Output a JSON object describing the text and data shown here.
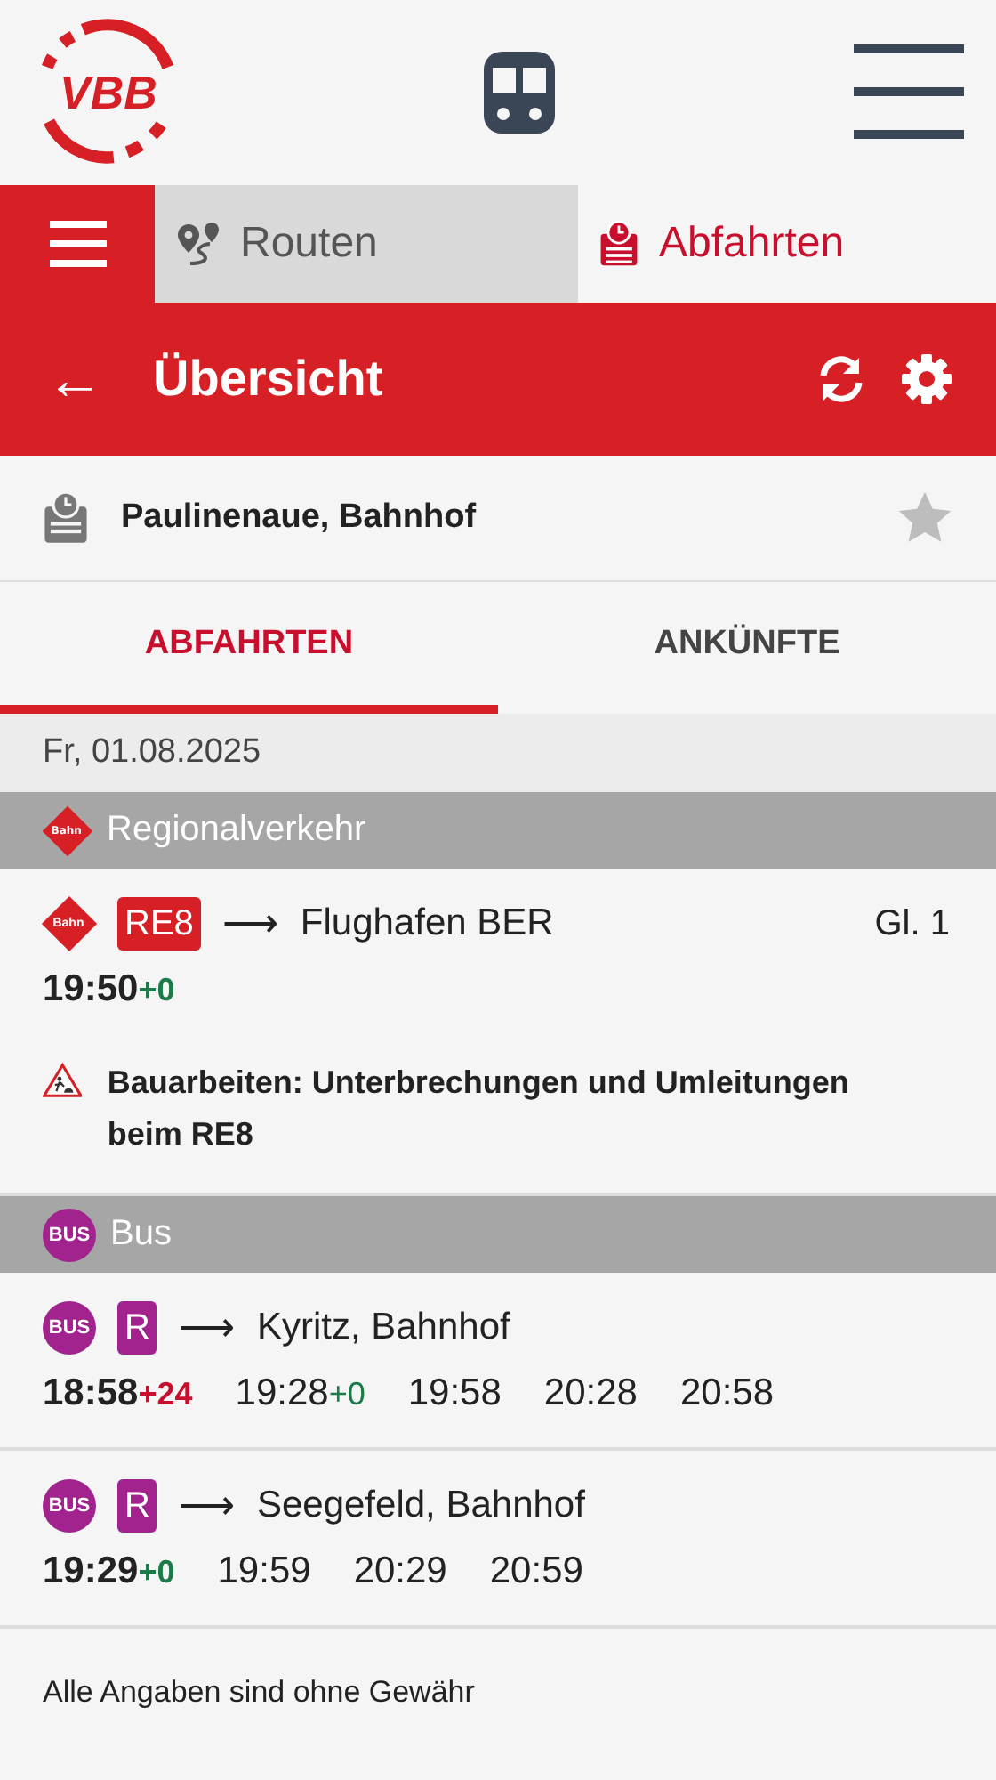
{
  "header": {
    "logo": "VBB"
  },
  "nav_tabs": [
    {
      "label": "Routen",
      "selected": false,
      "kind": "routes"
    },
    {
      "label": "Abfahrten",
      "selected": true,
      "kind": "departures"
    }
  ],
  "toolbar": {
    "back": "←",
    "title": "Übersicht"
  },
  "stop": {
    "name": "Paulinenaue, Bahnhof",
    "favorite": false
  },
  "tabs": [
    {
      "label": "ABFAHRTEN",
      "selected": true
    },
    {
      "label": "ANKÜNFTE",
      "selected": false
    }
  ],
  "date": "Fr, 01.08.2025",
  "sections": [
    {
      "title": "Regionalverkehr",
      "kind": "bahn",
      "mode_label": "Bahn",
      "entries": [
        {
          "mode_label": "Bahn",
          "line": "RE8",
          "color": "#d71f26",
          "arrow": "⟶",
          "destination": "Flughafen BER",
          "platform": "Gl. 1",
          "times": [
            {
              "time": "19:50",
              "delay": "+0",
              "late": false
            }
          ],
          "notice": "Bauarbeiten: Unterbrechungen und Umleitungen beim RE8"
        }
      ]
    },
    {
      "title": "Bus",
      "kind": "bus",
      "mode_label": "BUS",
      "entries": [
        {
          "mode_label": "BUS",
          "line": "R",
          "color": "#a3238e",
          "arrow": "⟶",
          "destination": "Kyritz, Bahnhof",
          "times": [
            {
              "time": "18:58",
              "delay": "+24",
              "late": true
            },
            {
              "time": "19:28",
              "delay": "+0",
              "late": false
            },
            {
              "time": "19:58"
            },
            {
              "time": "20:28"
            },
            {
              "time": "20:58"
            }
          ]
        },
        {
          "mode_label": "BUS",
          "line": "R",
          "color": "#a3238e",
          "arrow": "⟶",
          "destination": "Seegefeld, Bahnhof",
          "times": [
            {
              "time": "19:29",
              "delay": "+0",
              "late": false
            },
            {
              "time": "19:59"
            },
            {
              "time": "20:29"
            },
            {
              "time": "20:59"
            }
          ]
        }
      ]
    }
  ],
  "footer": "Alle Angaben sind ohne Gewähr"
}
